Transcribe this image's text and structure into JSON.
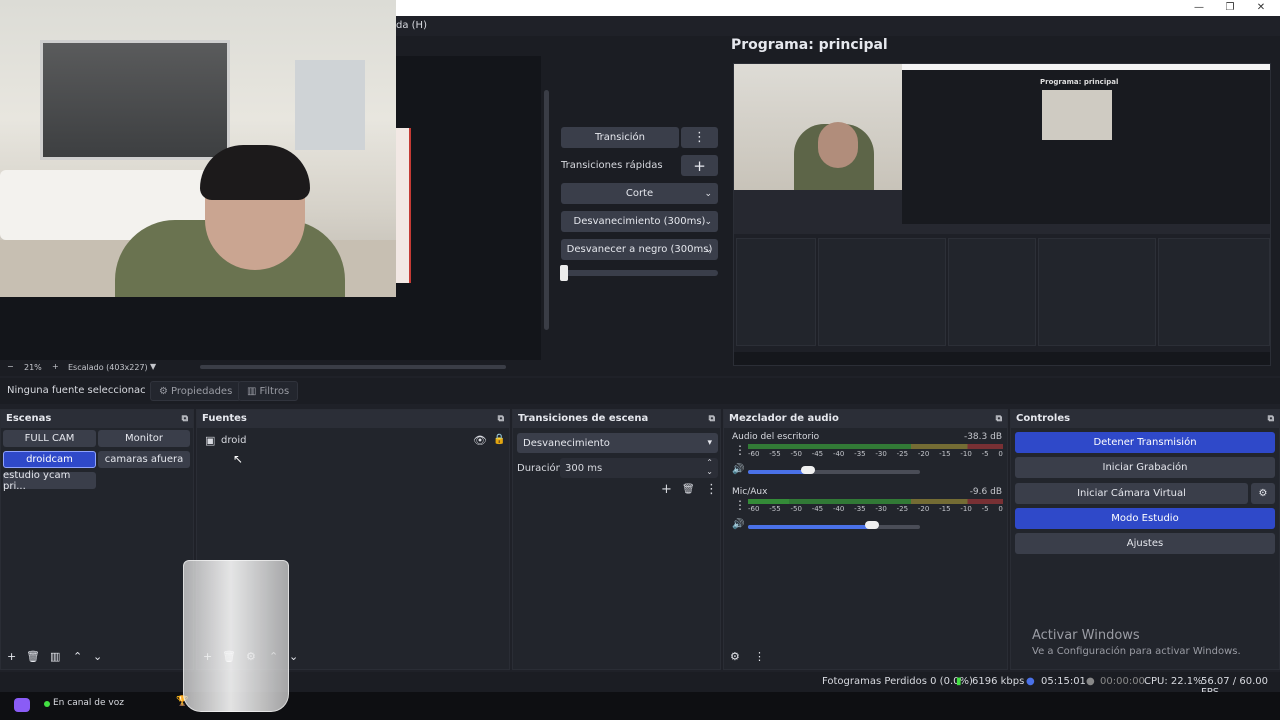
{
  "window": {
    "menu_fragment": "da (H)",
    "minimize": "—",
    "maximize": "❐",
    "close": "✕"
  },
  "preview": {
    "zoom_minus": "−",
    "zoom_value": "21%",
    "zoom_plus": "+",
    "scale_label": "Escalado (403x227)",
    "scale_chevron": "▼"
  },
  "transitions_panel": {
    "transition_button": "Transición",
    "quick_transitions_label": "Transiciones rápidas",
    "quick_items": [
      "Corte",
      "Desvanecimiento (300ms)",
      "Desvanecer a negro (300ms)"
    ]
  },
  "program": {
    "title": "Programa: principal",
    "inner_title": "Programa: principal"
  },
  "properties_bar": {
    "no_source": "Ninguna fuente seleccionac",
    "properties": "Propiedades",
    "filters": "Filtros"
  },
  "scenes": {
    "title": "Escenas",
    "items": [
      "FULL CAM",
      "Monitor",
      "droidcam",
      "camaras afuera",
      "estudio ycam pri..."
    ],
    "active_index": 2
  },
  "sources": {
    "title": "Fuentes",
    "items": [
      {
        "name": "droid",
        "visible": true,
        "locked": true
      }
    ]
  },
  "scene_transitions": {
    "title": "Transiciones de escena",
    "selected": "Desvanecimiento",
    "duration_label": "Duración",
    "duration_value": "300 ms"
  },
  "audio_mixer": {
    "title": "Mezclador de audio",
    "channels": [
      {
        "name": "Audio del escritorio",
        "db": "-38.3 dB",
        "level": 0.0,
        "volume": 0.35
      },
      {
        "name": "Mic/Aux",
        "db": "-9.6 dB",
        "level": 0.16,
        "volume": 0.72
      }
    ],
    "scale": [
      "-60",
      "-55",
      "-50",
      "-45",
      "-40",
      "-35",
      "-30",
      "-25",
      "-20",
      "-15",
      "-10",
      "-5",
      "0"
    ]
  },
  "controls": {
    "title": "Controles",
    "stop_streaming": "Detener Transmisión",
    "start_recording": "Iniciar Grabación",
    "start_virtual_cam": "Iniciar Cámara Virtual",
    "studio_mode": "Modo Estudio",
    "settings": "Ajustes"
  },
  "watermark": {
    "line1": "Activar Windows",
    "line2": "Ve a Configuración para activar Windows."
  },
  "status": {
    "dropped_frames": "Fotogramas Perdidos 0 (0.0%)",
    "bitrate": "6196 kbps",
    "stream_time": "05:15:01",
    "record_time": "00:00:00",
    "cpu": "CPU: 22.1%",
    "fps": "56.07 / 60.00 FPS"
  },
  "taskbar": {
    "voice_status": "En canal de voz"
  },
  "colors": {
    "accent": "#2f49c9",
    "panel": "#22252c",
    "background": "#1f2128",
    "meter_green": "#43e043"
  }
}
